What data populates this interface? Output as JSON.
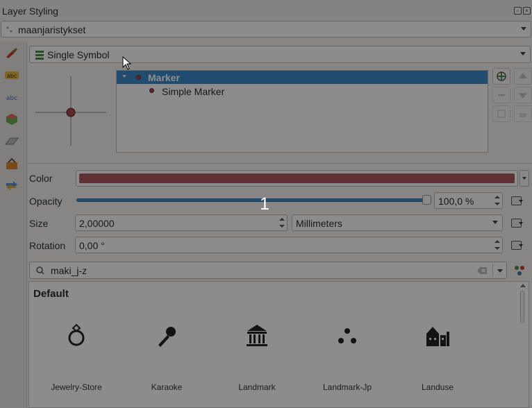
{
  "panel": {
    "title": "Layer Styling"
  },
  "layer_selector": {
    "value": "maanjaristykset"
  },
  "renderer": {
    "value": "Single Symbol"
  },
  "symbol_tree": {
    "items": [
      {
        "label": "Marker",
        "selected": true
      },
      {
        "label": "Simple Marker",
        "selected": false
      }
    ]
  },
  "properties": {
    "color": {
      "label": "Color",
      "value": "#a85a5e"
    },
    "opacity": {
      "label": "Opacity",
      "value": "100,0 %",
      "slider_fraction": 1.0
    },
    "size": {
      "label": "Size",
      "value": "2,00000",
      "unit": "Millimeters"
    },
    "rotation": {
      "label": "Rotation",
      "value": "0,00 °"
    }
  },
  "search": {
    "value": "maki_j-z"
  },
  "library": {
    "group": "Default",
    "symbols": [
      {
        "name": "Jewelry-Store",
        "icon": "ring-icon"
      },
      {
        "name": "Karaoke",
        "icon": "microphone-icon"
      },
      {
        "name": "Landmark",
        "icon": "landmark-icon"
      },
      {
        "name": "Landmark-Jp",
        "icon": "three-dots-icon"
      },
      {
        "name": "Landuse",
        "icon": "landuse-icon"
      }
    ]
  },
  "overlay": {
    "step_number": "1"
  }
}
